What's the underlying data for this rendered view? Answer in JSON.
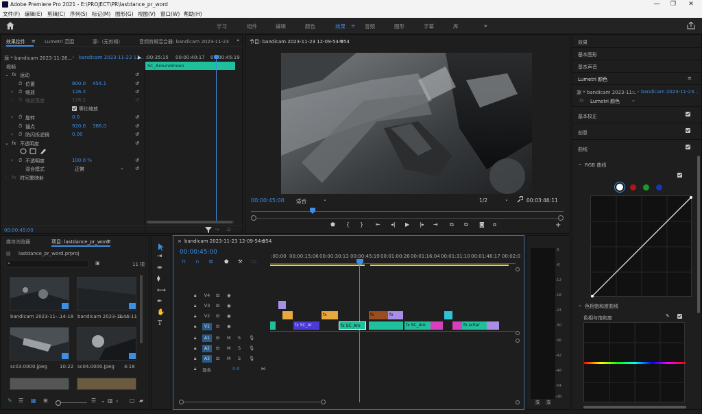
{
  "window": {
    "title": "Adobe Premiere Pro 2021 - E:\\PROJECT\\PR\\lastdance_pr_word",
    "minimize": "—",
    "maximize": "❐",
    "close": "✕"
  },
  "menu": [
    "文件(F)",
    "编辑(E)",
    "剪辑(C)",
    "序列(S)",
    "标记(M)",
    "图形(G)",
    "视图(V)",
    "窗口(W)",
    "帮助(H)"
  ],
  "workspaces": [
    "学习",
    "组件",
    "编辑",
    "颜色",
    "效果",
    "音频",
    "图形",
    "字幕",
    "库"
  ],
  "active_workspace": "效果",
  "effect_controls": {
    "tabs": [
      "效果控件",
      "Lumetri 范围",
      "源:（无剪辑）",
      "音频剪辑混合器: bandicam 2023-11-23"
    ],
    "source": "源 * bandicam 2023-11-26...",
    "sequence": "bandicam 2023-11-23 12...",
    "ruler": [
      ":00:35:15",
      "00:00:40:17",
      "00:00:45:19"
    ],
    "clip_name": "SC_Aroundmoon",
    "section_video": "视频",
    "motion": "运动",
    "position_label": "位置",
    "position_x": "800.0",
    "position_y": "454.1",
    "scale_label": "缩放",
    "scale_value": "126.2",
    "scale_width_label": "缩放宽度",
    "scale_width_value": "126.2",
    "uniform_scale_label": "等比缩放",
    "rotation_label": "旋转",
    "rotation_value": "0.0",
    "anchor_label": "锚点",
    "anchor_x": "920.0",
    "anchor_y": "386.0",
    "antiflicker_label": "防闪烁滤镜",
    "antiflicker_value": "0.00",
    "opacity_section": "不透明度",
    "opacity_label": "不透明度",
    "opacity_value": "100.0 %",
    "blend_label": "混合模式",
    "blend_value": "正常",
    "time_remap": "时间重映射",
    "timecode": "00:00:45:00"
  },
  "program": {
    "title": "节目: bandicam 2023-11-23 12-09-54-954",
    "timecode": "00:00:45:00",
    "fit": "适合",
    "resolution": "1/2",
    "duration": "00:03:46:11"
  },
  "project": {
    "tabs": [
      "媒体浏览器",
      "项目: lastdance_pr_word"
    ],
    "file": "lastdance_pr_word.prproj",
    "count": "11 项",
    "items": [
      {
        "name": "bandicam 2023-11-...",
        "dur": "14:18"
      },
      {
        "name": "bandicam 2023-11...",
        "dur": "3:46:11"
      },
      {
        "name": "sc03.0000.jpeg",
        "dur": "10:22"
      },
      {
        "name": "sc04.0000.jpeg",
        "dur": "4:18"
      }
    ]
  },
  "timeline": {
    "title": "bandicam 2023-11-23 12-09-54-954",
    "timecode": "00:00:45:00",
    "ruler": [
      ":00:00",
      "00:00:15:06",
      "00:00:30:13",
      "00:00:45:19",
      "00:01:00:26",
      "00:01:16:04",
      "00:01:31:10",
      "00:01:46:17",
      "00:02:0"
    ],
    "tracks": [
      "V4",
      "V3",
      "V2",
      "V1",
      "A1",
      "A2",
      "A3"
    ],
    "mix_label": "混合",
    "mix_value": "0.0",
    "clips": {
      "c1": "SC_Ar",
      "c2": "SC_Aro",
      "c3": "SC_Aro",
      "c4": "scEar"
    }
  },
  "meter": {
    "scale": [
      "0",
      "-6",
      "-12",
      "-18",
      "-24",
      "-30",
      "-36",
      "-42",
      "-48",
      "-54",
      "-dB"
    ],
    "solo": "S"
  },
  "effects_panel": {
    "items": [
      "效果",
      "基本图形",
      "基本声音",
      "Lumetri 颜色"
    ],
    "source": "源 * bandicam 2023-11...",
    "sequence": "bandicam 2023-11-23...",
    "fx_name": "Lumetri 颜色",
    "sections": [
      "基本校正",
      "创意",
      "曲线"
    ],
    "rgb_curve": "RGB 曲线",
    "hue_sat_curve": "色相饱和度曲线",
    "hue_vs_sat": "色相与饱和度"
  },
  "colors": {
    "accent": "#3d8ee6",
    "clip_teal": "#1fc19c",
    "clip_purple": "#a98ee6",
    "clip_orange": "#e6a93d",
    "clip_pink": "#d63fbd"
  }
}
